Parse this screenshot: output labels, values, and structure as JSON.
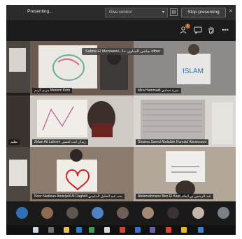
{
  "presenting_bar": {
    "status": "Presenting...",
    "give_control": "Give control",
    "stop_button": "Stop presenting"
  },
  "controls": {
    "icons": [
      "participants-icon",
      "chat-icon",
      "raise-hand-icon",
      "more-icon"
    ],
    "participants_badge": "1"
  },
  "pinned_label": "Salma El Mennaoui -1+ سلمى المناوي other",
  "tiles": [
    {
      "name": "مريم كريم Meriem Krim"
    },
    {
      "name": "Mira Hammadi ميرة حمادي"
    },
    {
      "name": "Zidan Ait Lahcen زيدان ايت لحسن"
    },
    {
      "name": "Shaima Saeed Abdallah Humaid Almansoori"
    },
    {
      "name": "Noor Nadiean Abdeljalil Al Daghidi بنت عبد الجليل الدغيدي"
    },
    {
      "name": "Abderrahmane Ben El Kaid عبد الرحمن بن الفائد"
    }
  ],
  "left_partial_names": [
    "نظيم",
    "طالب"
  ],
  "colors": {
    "accent": "#c9612c",
    "bar_bg": "#2b2b2b",
    "tile_bg": "#1f1f1f"
  }
}
